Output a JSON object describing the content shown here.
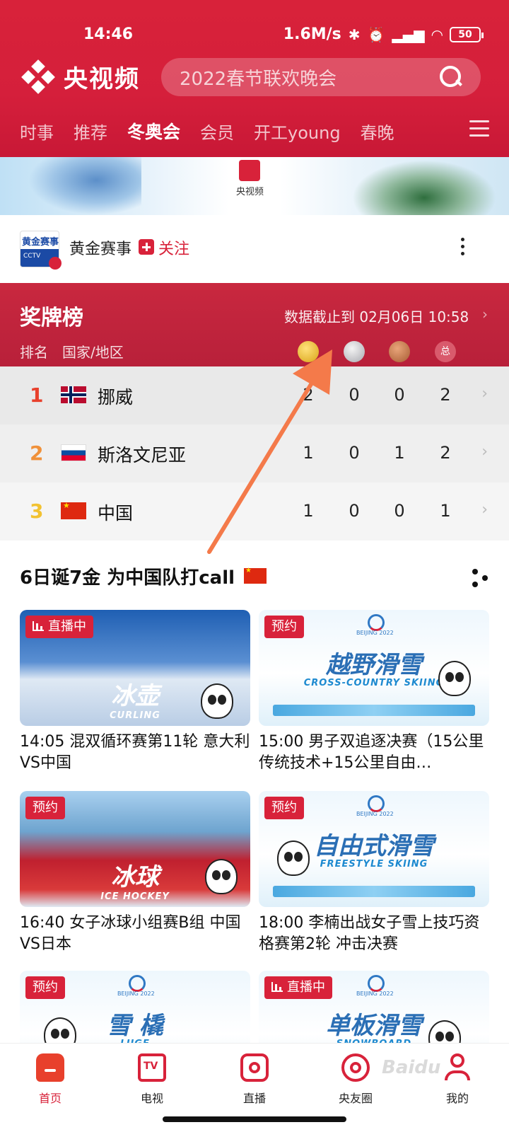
{
  "status_bar": {
    "time": "14:46",
    "network_speed": "1.6M/s",
    "battery": "50"
  },
  "app": {
    "name": "央视频"
  },
  "search": {
    "placeholder": "2022春节联欢晚会"
  },
  "tabs": [
    {
      "label": "时事"
    },
    {
      "label": "推荐"
    },
    {
      "label": "冬奥会",
      "active": true
    },
    {
      "label": "会员"
    },
    {
      "label": "开工young"
    },
    {
      "label": "春晚"
    }
  ],
  "banner": {
    "logo_text": "央视频"
  },
  "channel": {
    "avatar_text": "黄金赛事",
    "name": "黄金赛事",
    "follow_label": "关注"
  },
  "medal_table": {
    "title": "奖牌榜",
    "updated": "数据截止到 02月06日 10:58",
    "col_rank": "排名",
    "col_country": "国家/地区",
    "col_total_icon": "总",
    "rows": [
      {
        "rank": "1",
        "country": "挪威",
        "gold": "2",
        "silver": "0",
        "bronze": "0",
        "total": "2"
      },
      {
        "rank": "2",
        "country": "斯洛文尼亚",
        "gold": "1",
        "silver": "0",
        "bronze": "1",
        "total": "2"
      },
      {
        "rank": "3",
        "country": "中国",
        "gold": "1",
        "silver": "0",
        "bronze": "0",
        "total": "1"
      }
    ]
  },
  "section": {
    "title": "6日诞7金 为中国队打call"
  },
  "cards": [
    {
      "tag": "直播中",
      "big": "冰壶",
      "en": "CURLING",
      "caption": "14:05 混双循环赛第11轮 意大利VS中国"
    },
    {
      "tag": "预约",
      "big": "越野滑雪",
      "en": "CROSS-COUNTRY SKIING",
      "caption": "15:00 男子双追逐决赛（15公里传统技术+15公里自由…"
    },
    {
      "tag": "预约",
      "big": "冰球",
      "en": "ICE HOCKEY",
      "caption": "16:40 女子冰球小组赛B组 中国VS日本"
    },
    {
      "tag": "预约",
      "big": "自由式滑雪",
      "en": "FREESTYLE SKIING",
      "caption": "18:00 李楠出战女子雪上技巧资格赛第2轮 冲击决赛"
    },
    {
      "tag": "预约",
      "big": "雪 橇",
      "en": "LUGE",
      "caption": ""
    },
    {
      "tag": "直播中",
      "big": "单板滑雪",
      "en": "SNOWBOARD",
      "caption": ""
    }
  ],
  "bottom_nav": [
    {
      "label": "首页",
      "icon": "home-icon",
      "active": true
    },
    {
      "label": "电视",
      "icon": "tv-icon"
    },
    {
      "label": "直播",
      "icon": "live-icon"
    },
    {
      "label": "央友圈",
      "icon": "circle-icon"
    },
    {
      "label": "我的",
      "icon": "profile-icon"
    }
  ],
  "watermark": "Baidu",
  "colors": {
    "brand_red": "#d8223a",
    "arrow": "#f47a4a",
    "rank1": "#e8402c",
    "rank2": "#f0913a",
    "rank3": "#f2c231"
  }
}
